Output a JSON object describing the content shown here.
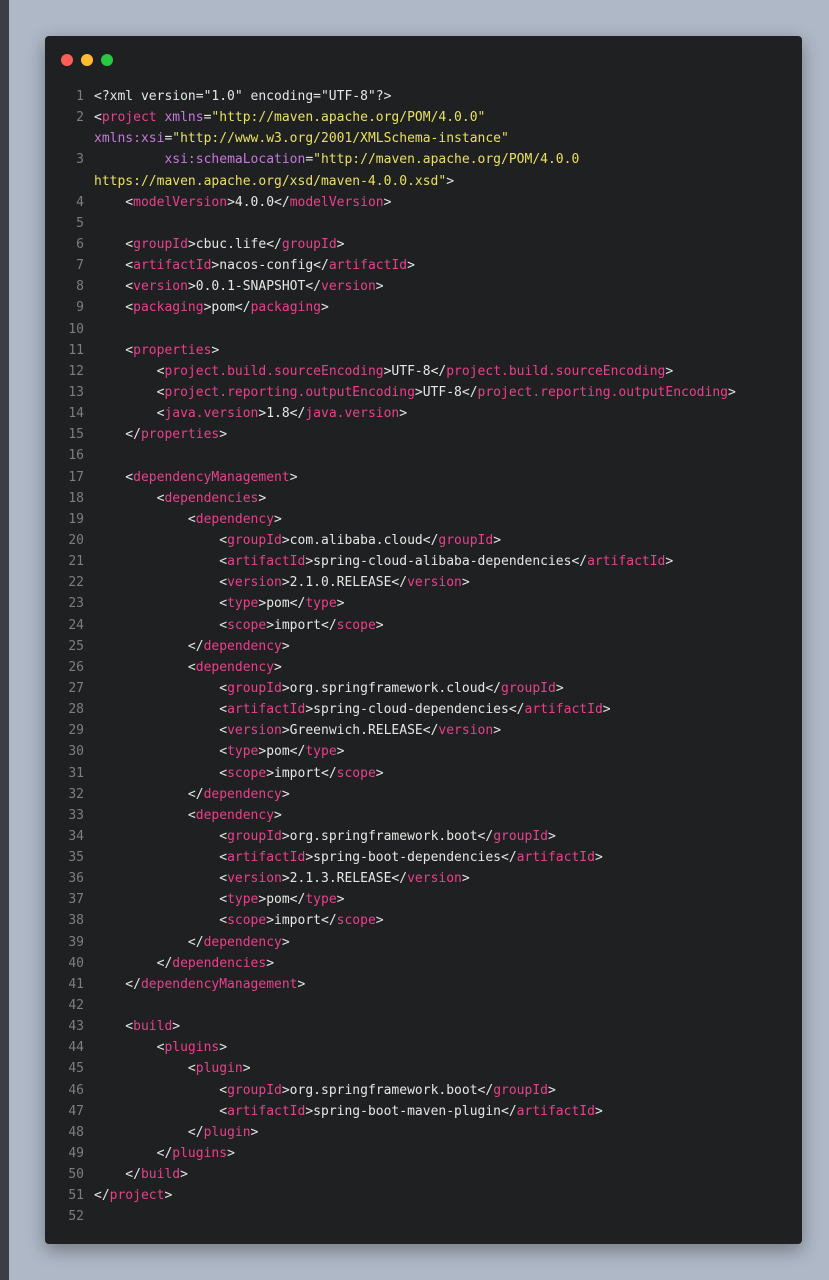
{
  "window": {
    "dots": [
      {
        "name": "close",
        "color": "#ff5f56"
      },
      {
        "name": "minimize",
        "color": "#ffbd2e"
      },
      {
        "name": "maximize",
        "color": "#27c93f"
      }
    ]
  },
  "colors": {
    "tag": "#e9408d",
    "attr": "#c678dd",
    "string": "#e9e05f",
    "text": "#e6e6e6",
    "line_number": "#7b7e83",
    "editor_bg": "#1f2021"
  },
  "code_lines": [
    {
      "n": "1",
      "tokens": [
        [
          "t",
          "<?xml version=\"1.0\" encoding=\"UTF-8\"?>"
        ]
      ]
    },
    {
      "n": "2",
      "tokens": [
        [
          "t",
          "<"
        ],
        [
          "g",
          "project"
        ],
        [
          "t",
          " "
        ],
        [
          "a",
          "xmlns"
        ],
        [
          "t",
          "="
        ],
        [
          "s",
          "\"http://maven.apache.org/POM/4.0.0\""
        ]
      ]
    },
    {
      "n": "",
      "tokens": [
        [
          "a",
          "xmlns:xsi"
        ],
        [
          "t",
          "="
        ],
        [
          "s",
          "\"http://www.w3.org/2001/XMLSchema-instance\""
        ]
      ]
    },
    {
      "n": "3",
      "tokens": [
        [
          "t",
          "         "
        ],
        [
          "a",
          "xsi:schemaLocation"
        ],
        [
          "t",
          "="
        ],
        [
          "s",
          "\"http://maven.apache.org/POM/4.0.0"
        ]
      ]
    },
    {
      "n": "",
      "tokens": [
        [
          "s",
          "https://maven.apache.org/xsd/maven-4.0.0.xsd\""
        ],
        [
          "t",
          ">"
        ]
      ]
    },
    {
      "n": "4",
      "tokens": [
        [
          "t",
          "    <"
        ],
        [
          "g",
          "modelVersion"
        ],
        [
          "t",
          ">4.0.0</"
        ],
        [
          "g",
          "modelVersion"
        ],
        [
          "t",
          ">"
        ]
      ]
    },
    {
      "n": "5",
      "tokens": []
    },
    {
      "n": "6",
      "tokens": [
        [
          "t",
          "    <"
        ],
        [
          "g",
          "groupId"
        ],
        [
          "t",
          ">cbuc.life</"
        ],
        [
          "g",
          "groupId"
        ],
        [
          "t",
          ">"
        ]
      ]
    },
    {
      "n": "7",
      "tokens": [
        [
          "t",
          "    <"
        ],
        [
          "g",
          "artifactId"
        ],
        [
          "t",
          ">nacos-config</"
        ],
        [
          "g",
          "artifactId"
        ],
        [
          "t",
          ">"
        ]
      ]
    },
    {
      "n": "8",
      "tokens": [
        [
          "t",
          "    <"
        ],
        [
          "g",
          "version"
        ],
        [
          "t",
          ">0.0.1-SNAPSHOT</"
        ],
        [
          "g",
          "version"
        ],
        [
          "t",
          ">"
        ]
      ]
    },
    {
      "n": "9",
      "tokens": [
        [
          "t",
          "    <"
        ],
        [
          "g",
          "packaging"
        ],
        [
          "t",
          ">pom</"
        ],
        [
          "g",
          "packaging"
        ],
        [
          "t",
          ">"
        ]
      ]
    },
    {
      "n": "10",
      "tokens": []
    },
    {
      "n": "11",
      "tokens": [
        [
          "t",
          "    <"
        ],
        [
          "g",
          "properties"
        ],
        [
          "t",
          ">"
        ]
      ]
    },
    {
      "n": "12",
      "tokens": [
        [
          "t",
          "        <"
        ],
        [
          "g",
          "project.build.sourceEncoding"
        ],
        [
          "t",
          ">UTF-8</"
        ],
        [
          "g",
          "project.build.sourceEncoding"
        ],
        [
          "t",
          ">"
        ]
      ]
    },
    {
      "n": "13",
      "tokens": [
        [
          "t",
          "        <"
        ],
        [
          "g",
          "project.reporting.outputEncoding"
        ],
        [
          "t",
          ">UTF-8</"
        ],
        [
          "g",
          "project.reporting.outputEncoding"
        ],
        [
          "t",
          ">"
        ]
      ]
    },
    {
      "n": "14",
      "tokens": [
        [
          "t",
          "        <"
        ],
        [
          "g",
          "java.version"
        ],
        [
          "t",
          ">1.8</"
        ],
        [
          "g",
          "java.version"
        ],
        [
          "t",
          ">"
        ]
      ]
    },
    {
      "n": "15",
      "tokens": [
        [
          "t",
          "    </"
        ],
        [
          "g",
          "properties"
        ],
        [
          "t",
          ">"
        ]
      ]
    },
    {
      "n": "16",
      "tokens": []
    },
    {
      "n": "17",
      "tokens": [
        [
          "t",
          "    <"
        ],
        [
          "g",
          "dependencyManagement"
        ],
        [
          "t",
          ">"
        ]
      ]
    },
    {
      "n": "18",
      "tokens": [
        [
          "t",
          "        <"
        ],
        [
          "g",
          "dependencies"
        ],
        [
          "t",
          ">"
        ]
      ]
    },
    {
      "n": "19",
      "tokens": [
        [
          "t",
          "            <"
        ],
        [
          "g",
          "dependency"
        ],
        [
          "t",
          ">"
        ]
      ]
    },
    {
      "n": "20",
      "tokens": [
        [
          "t",
          "                <"
        ],
        [
          "g",
          "groupId"
        ],
        [
          "t",
          ">com.alibaba.cloud</"
        ],
        [
          "g",
          "groupId"
        ],
        [
          "t",
          ">"
        ]
      ]
    },
    {
      "n": "21",
      "tokens": [
        [
          "t",
          "                <"
        ],
        [
          "g",
          "artifactId"
        ],
        [
          "t",
          ">spring-cloud-alibaba-dependencies</"
        ],
        [
          "g",
          "artifactId"
        ],
        [
          "t",
          ">"
        ]
      ]
    },
    {
      "n": "22",
      "tokens": [
        [
          "t",
          "                <"
        ],
        [
          "g",
          "version"
        ],
        [
          "t",
          ">2.1.0.RELEASE</"
        ],
        [
          "g",
          "version"
        ],
        [
          "t",
          ">"
        ]
      ]
    },
    {
      "n": "23",
      "tokens": [
        [
          "t",
          "                <"
        ],
        [
          "g",
          "type"
        ],
        [
          "t",
          ">pom</"
        ],
        [
          "g",
          "type"
        ],
        [
          "t",
          ">"
        ]
      ]
    },
    {
      "n": "24",
      "tokens": [
        [
          "t",
          "                <"
        ],
        [
          "g",
          "scope"
        ],
        [
          "t",
          ">import</"
        ],
        [
          "g",
          "scope"
        ],
        [
          "t",
          ">"
        ]
      ]
    },
    {
      "n": "25",
      "tokens": [
        [
          "t",
          "            </"
        ],
        [
          "g",
          "dependency"
        ],
        [
          "t",
          ">"
        ]
      ]
    },
    {
      "n": "26",
      "tokens": [
        [
          "t",
          "            <"
        ],
        [
          "g",
          "dependency"
        ],
        [
          "t",
          ">"
        ]
      ]
    },
    {
      "n": "27",
      "tokens": [
        [
          "t",
          "                <"
        ],
        [
          "g",
          "groupId"
        ],
        [
          "t",
          ">org.springframework.cloud</"
        ],
        [
          "g",
          "groupId"
        ],
        [
          "t",
          ">"
        ]
      ]
    },
    {
      "n": "28",
      "tokens": [
        [
          "t",
          "                <"
        ],
        [
          "g",
          "artifactId"
        ],
        [
          "t",
          ">spring-cloud-dependencies</"
        ],
        [
          "g",
          "artifactId"
        ],
        [
          "t",
          ">"
        ]
      ]
    },
    {
      "n": "29",
      "tokens": [
        [
          "t",
          "                <"
        ],
        [
          "g",
          "version"
        ],
        [
          "t",
          ">Greenwich.RELEASE</"
        ],
        [
          "g",
          "version"
        ],
        [
          "t",
          ">"
        ]
      ]
    },
    {
      "n": "30",
      "tokens": [
        [
          "t",
          "                <"
        ],
        [
          "g",
          "type"
        ],
        [
          "t",
          ">pom</"
        ],
        [
          "g",
          "type"
        ],
        [
          "t",
          ">"
        ]
      ]
    },
    {
      "n": "31",
      "tokens": [
        [
          "t",
          "                <"
        ],
        [
          "g",
          "scope"
        ],
        [
          "t",
          ">import</"
        ],
        [
          "g",
          "scope"
        ],
        [
          "t",
          ">"
        ]
      ]
    },
    {
      "n": "32",
      "tokens": [
        [
          "t",
          "            </"
        ],
        [
          "g",
          "dependency"
        ],
        [
          "t",
          ">"
        ]
      ]
    },
    {
      "n": "33",
      "tokens": [
        [
          "t",
          "            <"
        ],
        [
          "g",
          "dependency"
        ],
        [
          "t",
          ">"
        ]
      ]
    },
    {
      "n": "34",
      "tokens": [
        [
          "t",
          "                <"
        ],
        [
          "g",
          "groupId"
        ],
        [
          "t",
          ">org.springframework.boot</"
        ],
        [
          "g",
          "groupId"
        ],
        [
          "t",
          ">"
        ]
      ]
    },
    {
      "n": "35",
      "tokens": [
        [
          "t",
          "                <"
        ],
        [
          "g",
          "artifactId"
        ],
        [
          "t",
          ">spring-boot-dependencies</"
        ],
        [
          "g",
          "artifactId"
        ],
        [
          "t",
          ">"
        ]
      ]
    },
    {
      "n": "36",
      "tokens": [
        [
          "t",
          "                <"
        ],
        [
          "g",
          "version"
        ],
        [
          "t",
          ">2.1.3.RELEASE</"
        ],
        [
          "g",
          "version"
        ],
        [
          "t",
          ">"
        ]
      ]
    },
    {
      "n": "37",
      "tokens": [
        [
          "t",
          "                <"
        ],
        [
          "g",
          "type"
        ],
        [
          "t",
          ">pom</"
        ],
        [
          "g",
          "type"
        ],
        [
          "t",
          ">"
        ]
      ]
    },
    {
      "n": "38",
      "tokens": [
        [
          "t",
          "                <"
        ],
        [
          "g",
          "scope"
        ],
        [
          "t",
          ">import</"
        ],
        [
          "g",
          "scope"
        ],
        [
          "t",
          ">"
        ]
      ]
    },
    {
      "n": "39",
      "tokens": [
        [
          "t",
          "            </"
        ],
        [
          "g",
          "dependency"
        ],
        [
          "t",
          ">"
        ]
      ]
    },
    {
      "n": "40",
      "tokens": [
        [
          "t",
          "        </"
        ],
        [
          "g",
          "dependencies"
        ],
        [
          "t",
          ">"
        ]
      ]
    },
    {
      "n": "41",
      "tokens": [
        [
          "t",
          "    </"
        ],
        [
          "g",
          "dependencyManagement"
        ],
        [
          "t",
          ">"
        ]
      ]
    },
    {
      "n": "42",
      "tokens": []
    },
    {
      "n": "43",
      "tokens": [
        [
          "t",
          "    <"
        ],
        [
          "g",
          "build"
        ],
        [
          "t",
          ">"
        ]
      ]
    },
    {
      "n": "44",
      "tokens": [
        [
          "t",
          "        <"
        ],
        [
          "g",
          "plugins"
        ],
        [
          "t",
          ">"
        ]
      ]
    },
    {
      "n": "45",
      "tokens": [
        [
          "t",
          "            <"
        ],
        [
          "g",
          "plugin"
        ],
        [
          "t",
          ">"
        ]
      ]
    },
    {
      "n": "46",
      "tokens": [
        [
          "t",
          "                <"
        ],
        [
          "g",
          "groupId"
        ],
        [
          "t",
          ">org.springframework.boot</"
        ],
        [
          "g",
          "groupId"
        ],
        [
          "t",
          ">"
        ]
      ]
    },
    {
      "n": "47",
      "tokens": [
        [
          "t",
          "                <"
        ],
        [
          "g",
          "artifactId"
        ],
        [
          "t",
          ">spring-boot-maven-plugin</"
        ],
        [
          "g",
          "artifactId"
        ],
        [
          "t",
          ">"
        ]
      ]
    },
    {
      "n": "48",
      "tokens": [
        [
          "t",
          "            </"
        ],
        [
          "g",
          "plugin"
        ],
        [
          "t",
          ">"
        ]
      ]
    },
    {
      "n": "49",
      "tokens": [
        [
          "t",
          "        </"
        ],
        [
          "g",
          "plugins"
        ],
        [
          "t",
          ">"
        ]
      ]
    },
    {
      "n": "50",
      "tokens": [
        [
          "t",
          "    </"
        ],
        [
          "g",
          "build"
        ],
        [
          "t",
          ">"
        ]
      ]
    },
    {
      "n": "51",
      "tokens": [
        [
          "t",
          "</"
        ],
        [
          "g",
          "project"
        ],
        [
          "t",
          ">"
        ]
      ]
    },
    {
      "n": "52",
      "tokens": []
    }
  ]
}
